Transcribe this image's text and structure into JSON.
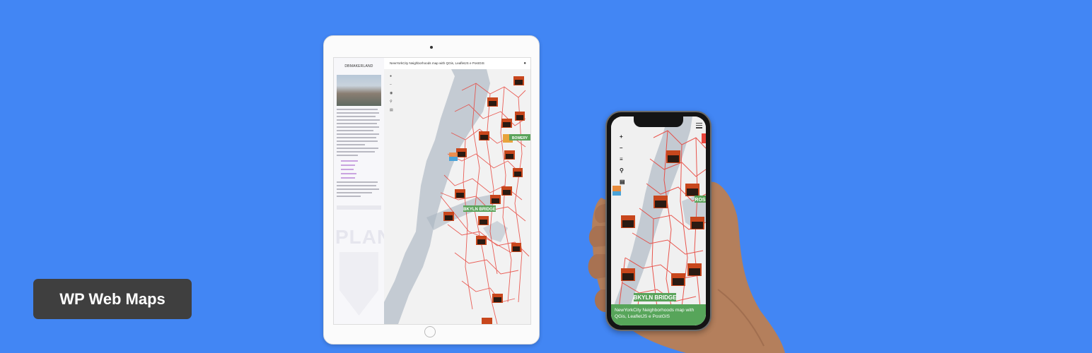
{
  "badge": {
    "label": "WP Web Maps"
  },
  "tablet": {
    "sidebar_title": "DBMAKERLAND",
    "plan_text": "PLAN",
    "header_title": "NewYorkCity Neighborhoods map with QGis, LeafletJS e PostGIS",
    "bridge_label": "BKYLN BRIDGE",
    "side_label": "BOWERY",
    "controls": [
      "+",
      "−",
      "≡",
      "⌕",
      "▤"
    ]
  },
  "phone": {
    "caption": "NewYorkCity Neighborhoods map with QGis, LeafletJS e PostGIS",
    "bridge_label": "BKYLN BRIDGE",
    "side_label": "ROS",
    "controls": [
      "+",
      "−",
      "≡",
      "⌕",
      "▤"
    ]
  },
  "colors": {
    "background": "#4286f4",
    "badge": "#3f3f3f",
    "route": "#e8453c",
    "water": "#aab6c2",
    "caption_bar": "#57a55a"
  },
  "icons": [
    "bell-icon",
    "menu-icon",
    "zoom-in-icon",
    "zoom-out-icon",
    "layers-icon",
    "search-icon",
    "print-icon",
    "marker-icon"
  ]
}
